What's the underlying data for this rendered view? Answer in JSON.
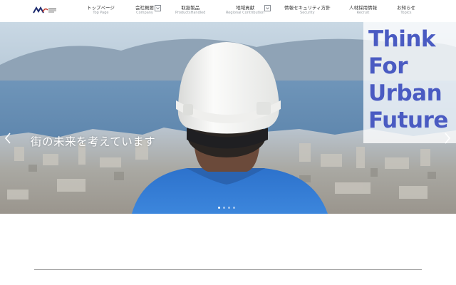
{
  "nav": {
    "items": [
      {
        "jp": "トップページ",
        "en": "Top Page"
      },
      {
        "jp": "会社概要",
        "en": "Company"
      },
      {
        "jp": "取扱製品",
        "en": "ProductsHandled"
      },
      {
        "jp": "地域貢献",
        "en": "Regional Contribution"
      },
      {
        "jp": "情報セキュリティ方針",
        "en": "Security"
      },
      {
        "jp": "人材採用情報",
        "en": "Recruit"
      },
      {
        "jp": "お知らせ",
        "en": "Topics"
      }
    ]
  },
  "hero": {
    "catchphrase": "街の未来を考えています",
    "tagline": [
      "Think",
      "For",
      "Urban",
      "Future"
    ],
    "slide_count": 4,
    "active_slide": 0
  },
  "colors": {
    "accent": "#4a5bc2",
    "helmet": "#f4f4f2",
    "shirt": "#2a6fc9"
  }
}
